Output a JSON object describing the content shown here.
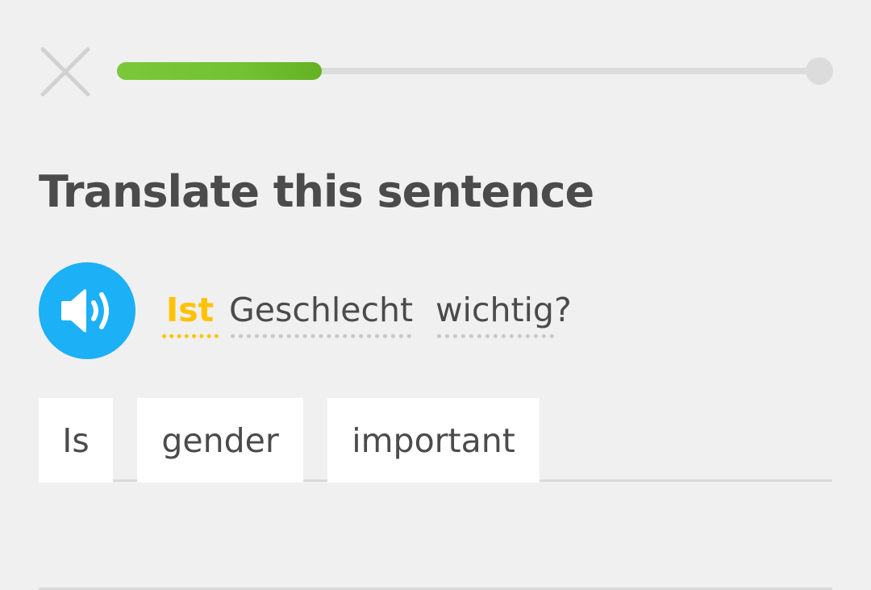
{
  "header": {
    "close_icon": "close-icon",
    "progress": 0.29
  },
  "challenge": {
    "title": "Translate this sentence",
    "speaker_icon": "speaker-icon",
    "sentence": {
      "words": [
        {
          "text": "Ist",
          "is_new": true,
          "color": "#ffc200"
        },
        {
          "text": "Geschlecht",
          "is_new": false
        },
        {
          "text": "wichtig?",
          "is_new": false
        }
      ]
    }
  },
  "answer": {
    "tiles": [
      "Is",
      "gender",
      "important"
    ]
  },
  "colors": {
    "background": "#f0f0f0",
    "progress_green": "#72c233",
    "speaker_blue": "#1cb0f6",
    "new_word_yellow": "#ffc200",
    "text": "#4b4b4b",
    "tile": "#ffffff"
  }
}
